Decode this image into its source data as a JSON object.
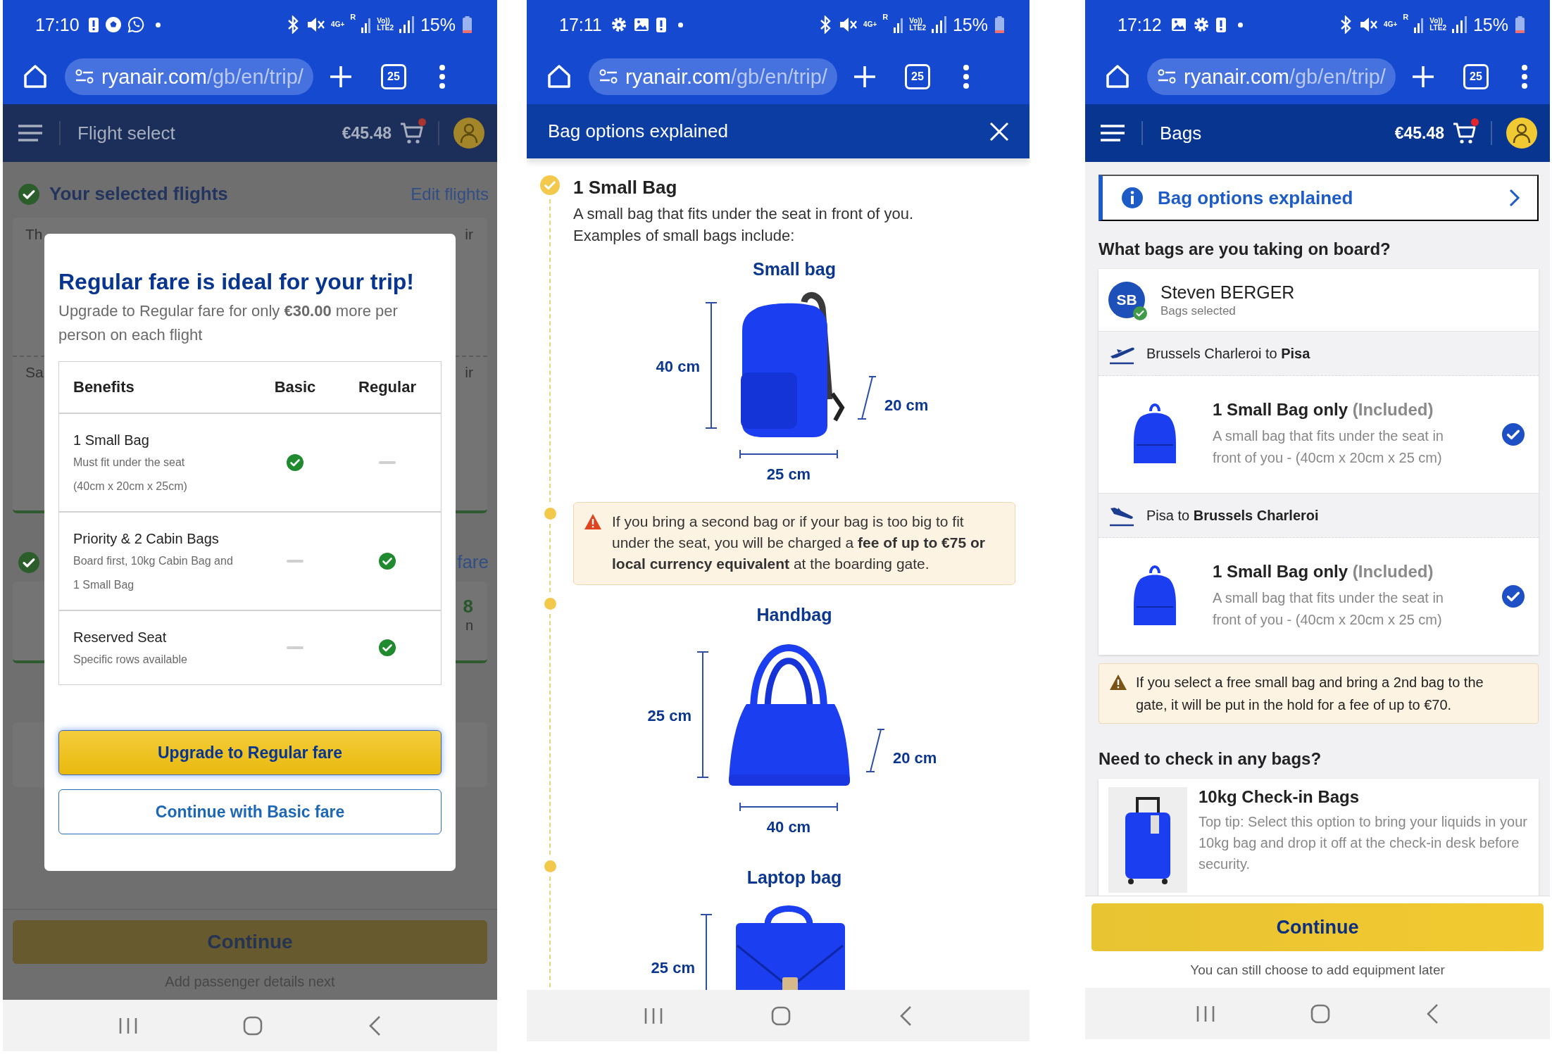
{
  "screens": [
    {
      "kind": "fare_upgrade",
      "status_bar": {
        "time": "17:10",
        "notifications": [
          {
            "kind": "alert"
          },
          {
            "kind": "ball"
          },
          {
            "kind": "chat"
          }
        ],
        "network": "4G+",
        "roaming": "R",
        "volte": "Vo))",
        "sim": "LTE2",
        "battery": "15%"
      },
      "browser": {
        "domain": "ryanair.com",
        "path": "/gb/en/trip/",
        "tab_count": "25"
      },
      "app_header": {
        "title": "Flight select",
        "price": "€45.48",
        "cart_badge": true
      },
      "background": {
        "title": "Your selected flights",
        "link": "Edit flights",
        "fragments": [
          [
            "Th",
            "ir"
          ],
          [
            "Sa",
            "ir"
          ]
        ],
        "link_2": "fare",
        "fragments_2": [
          "8",
          "n"
        ],
        "button": "Continue",
        "note": "Add passenger details next"
      },
      "dialog": {
        "title": "Regular fare is ideal for your trip!",
        "subtitle": "Upgrade to Regular fare for only **€30.00** more per person on each flight",
        "columns": [
          "Benefits",
          "Basic",
          "Regular"
        ],
        "rows": [
          {
            "name": "1 Small Bag",
            "detail_lines": [
              "Must fit under the seat",
              "(40cm x 20cm x 25cm)"
            ],
            "basic": true,
            "regular": false
          },
          {
            "name": "Priority & 2 Cabin Bags",
            "detail_lines": [
              "Board first, 10kg Cabin Bag and",
              "1 Small Bag"
            ],
            "basic": false,
            "regular": true
          },
          {
            "name": "Reserved Seat",
            "detail_lines": [
              "Specific rows available"
            ],
            "basic": false,
            "regular": true
          }
        ],
        "primary_button": "Upgrade to Regular fare",
        "secondary_button": "Continue with Basic fare"
      }
    },
    {
      "kind": "bag_info",
      "status_bar": {
        "time": "17:11",
        "notifications": [
          {
            "kind": "gear"
          },
          {
            "kind": "image"
          },
          {
            "kind": "alert"
          }
        ],
        "network": "4G+",
        "roaming": "R",
        "volte": "Vo))",
        "sim": "LTE2",
        "battery": "15%"
      },
      "browser": {
        "domain": "ryanair.com",
        "path": "/gb/en/trip/",
        "tab_count": "25"
      },
      "panel_header": {
        "title": "Bag options explained"
      },
      "timeline": [
        {
          "kind": "section",
          "marker": {
            "kind": "check"
          },
          "title": "1 Small Bag",
          "text": "A small bag that fits under the seat in front of you. Examples of small bags include:"
        },
        {
          "kind": "bag",
          "marker": {
            "kind": "none"
          },
          "title": "Small bag",
          "picture": {
            "kind": "backpack"
          },
          "height": "40 cm",
          "depth": "20 cm",
          "width": "25 cm"
        },
        {
          "kind": "warning",
          "marker": {
            "kind": "dot"
          },
          "text": "If you bring a second bag or if your bag is too big to fit under the seat, you will be charged a **fee of up to €75 or local currency equivalent** at the boarding gate."
        },
        {
          "kind": "bag",
          "marker": {
            "kind": "dot"
          },
          "title": "Handbag",
          "picture": {
            "kind": "handbag"
          },
          "height": "25 cm",
          "depth": "20 cm",
          "width": "40 cm"
        },
        {
          "kind": "bag",
          "marker": {
            "kind": "dot"
          },
          "title": "Laptop bag",
          "picture": {
            "kind": "briefcase"
          },
          "height": "25 cm"
        }
      ]
    },
    {
      "kind": "bags",
      "status_bar": {
        "time": "17:12",
        "notifications": [
          {
            "kind": "image"
          },
          {
            "kind": "gear"
          },
          {
            "kind": "alert"
          }
        ],
        "network": "4G+",
        "roaming": "R",
        "volte": "Vo))",
        "sim": "LTE2",
        "battery": "15%"
      },
      "browser": {
        "domain": "ryanair.com",
        "path": "/gb/en/trip/",
        "tab_count": "25"
      },
      "app_header": {
        "title": "Bags",
        "price": "€45.48",
        "cart_badge": true
      },
      "info_banner": {
        "label": "Bag options explained"
      },
      "heading": "What bags are you taking on board?",
      "passenger": {
        "initials": "SB",
        "name": "Steven BERGER",
        "status": "Bags selected",
        "done": true
      },
      "flights": [
        {
          "kind": "outbound",
          "route": "Brussels Charleroi to **Pisa**",
          "option": {
            "title": "1 Small Bag only",
            "tag": "(Included)",
            "text": "A small bag that fits under the seat in front of you - (40cm x 20cm x 25 cm)",
            "selected": true
          }
        },
        {
          "kind": "inbound",
          "route": "Pisa to **Brussels Charleroi**",
          "option": {
            "title": "1 Small Bag only",
            "tag": "(Included)",
            "text": "A small bag that fits under the seat in front of you - (40cm x 20cm x 25 cm)",
            "selected": true
          }
        }
      ],
      "warning": "If you select a free small bag and bring a 2nd bag to the gate, it will be put in the hold for a fee of up to €70.",
      "checkin_heading": "Need to check in any bags?",
      "checkin": {
        "title": "10kg Check-in Bags",
        "text": "Top tip: Select this option to bring your liquids in your 10kg bag and drop it off at the check-in desk before security."
      },
      "footer": {
        "button": "Continue",
        "note": "You can still choose to add equipment later"
      }
    }
  ]
}
